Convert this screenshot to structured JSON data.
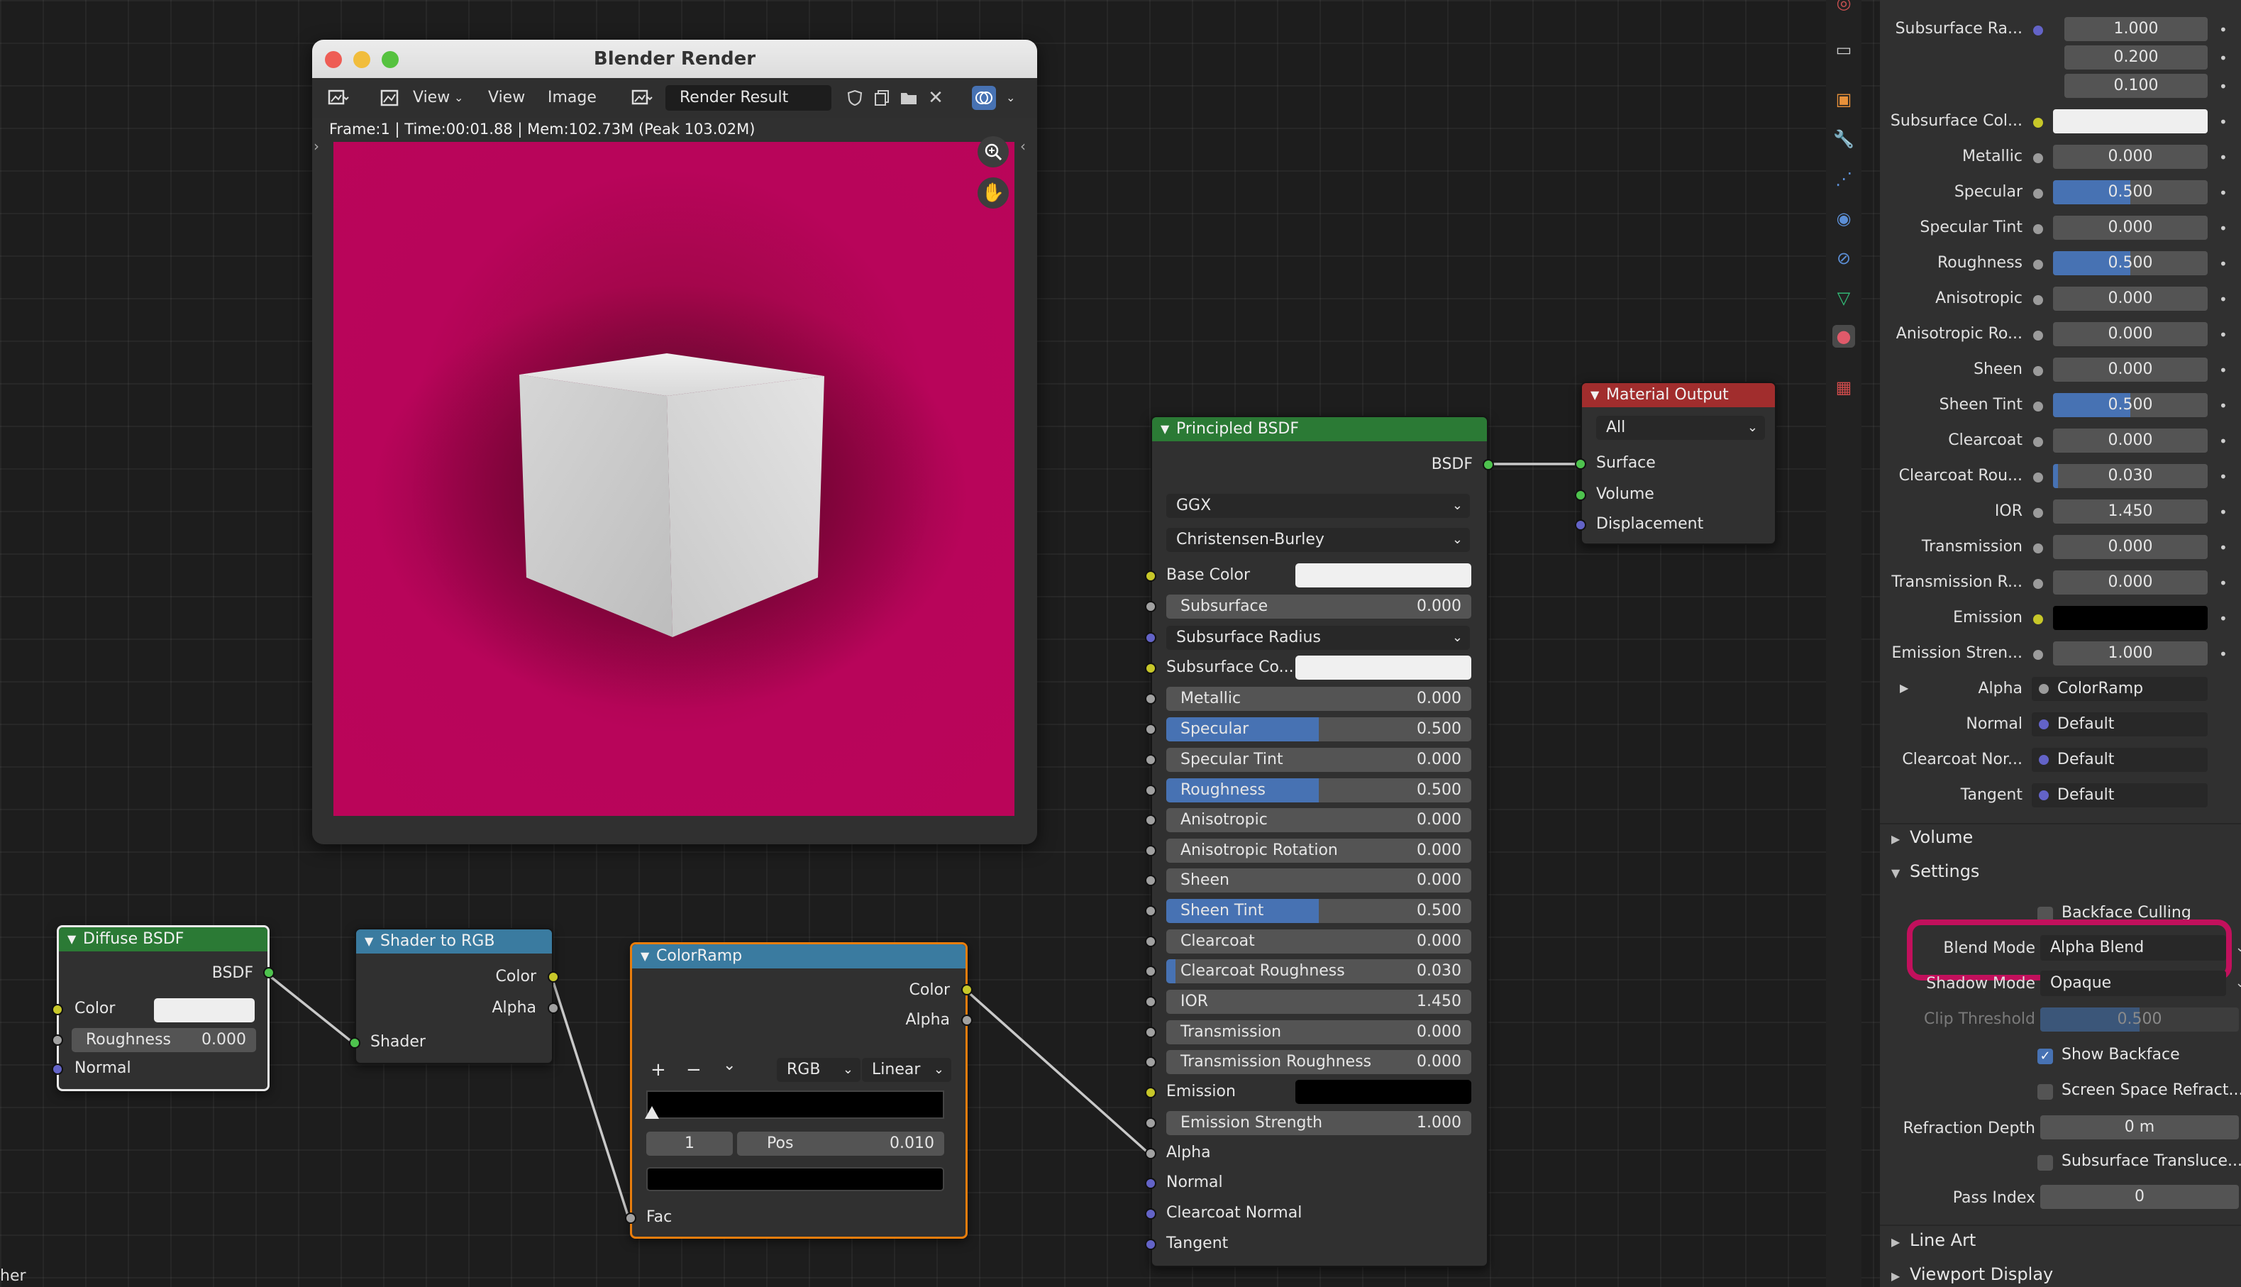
{
  "render_window": {
    "title": "Blender Render",
    "menu": [
      "View",
      "View",
      "Image"
    ],
    "result_name": "Render Result",
    "status": "Frame:1 | Time:00:01.88 | Mem:102.73M (Peak 103.02M)"
  },
  "bottom_left_text": "her",
  "diffuse_bsdf": {
    "title": "Diffuse BSDF",
    "output": "BSDF",
    "color_label": "Color",
    "roughness_label": "Roughness",
    "roughness_value": "0.000",
    "normal_label": "Normal"
  },
  "shader_to_rgb": {
    "title": "Shader to RGB",
    "out_color": "Color",
    "out_alpha": "Alpha",
    "in_shader": "Shader"
  },
  "color_ramp": {
    "title": "ColorRamp",
    "out_color": "Color",
    "out_alpha": "Alpha",
    "add": "+",
    "remove": "−",
    "more": "⌄",
    "color_mode": "RGB",
    "interpolation": "Linear",
    "index": "1",
    "pos_label": "Pos",
    "pos_value": "0.010",
    "in_fac": "Fac"
  },
  "principled_bsdf": {
    "title": "Principled BSDF",
    "output": "BSDF",
    "distribution": "GGX",
    "subsurface_method": "Christensen-Burley",
    "base_color_label": "Base Color",
    "subsurface_radius": "Subsurface Radius",
    "subsurface_color_label": "Subsurface Co...",
    "emission_label": "Emission",
    "fields": [
      {
        "label": "Subsurface",
        "value": "0.000",
        "fill": 0
      },
      {
        "label": "Metallic",
        "value": "0.000",
        "fill": 0
      },
      {
        "label": "Specular",
        "value": "0.500",
        "fill": 0.5
      },
      {
        "label": "Specular Tint",
        "value": "0.000",
        "fill": 0
      },
      {
        "label": "Roughness",
        "value": "0.500",
        "fill": 0.5
      },
      {
        "label": "Anisotropic",
        "value": "0.000",
        "fill": 0
      },
      {
        "label": "Anisotropic Rotation",
        "value": "0.000",
        "fill": 0
      },
      {
        "label": "Sheen",
        "value": "0.000",
        "fill": 0
      },
      {
        "label": "Sheen Tint",
        "value": "0.500",
        "fill": 0.5
      },
      {
        "label": "Clearcoat",
        "value": "0.000",
        "fill": 0
      },
      {
        "label": "Clearcoat Roughness",
        "value": "0.030",
        "fill": 0.03
      },
      {
        "label": "IOR",
        "value": "1.450",
        "fill": 0
      },
      {
        "label": "Transmission",
        "value": "0.000",
        "fill": 0
      },
      {
        "label": "Transmission Roughness",
        "value": "0.000",
        "fill": 0
      },
      {
        "label": "Emission Strength",
        "value": "1.000",
        "fill": 0
      }
    ],
    "inputs_bottom": [
      "Alpha",
      "Normal",
      "Clearcoat Normal",
      "Tangent"
    ]
  },
  "material_output": {
    "title": "Material Output",
    "target": "All",
    "inputs": [
      "Surface",
      "Volume",
      "Displacement"
    ]
  },
  "properties": {
    "subsurface_radius_label": "Subsurface Ra...",
    "subsurface_radius_values": [
      "1.000",
      "0.200",
      "0.100"
    ],
    "rows": [
      {
        "label": "Subsurface Col...",
        "kind": "color",
        "value": "",
        "fill": 0
      },
      {
        "label": "Metallic",
        "kind": "num",
        "value": "0.000",
        "fill": 0
      },
      {
        "label": "Specular",
        "kind": "num",
        "value": "0.500",
        "fill": 0.5
      },
      {
        "label": "Specular Tint",
        "kind": "num",
        "value": "0.000",
        "fill": 0
      },
      {
        "label": "Roughness",
        "kind": "num",
        "value": "0.500",
        "fill": 0.5
      },
      {
        "label": "Anisotropic",
        "kind": "num",
        "value": "0.000",
        "fill": 0
      },
      {
        "label": "Anisotropic Ro...",
        "kind": "num",
        "value": "0.000",
        "fill": 0
      },
      {
        "label": "Sheen",
        "kind": "num",
        "value": "0.000",
        "fill": 0
      },
      {
        "label": "Sheen Tint",
        "kind": "num",
        "value": "0.500",
        "fill": 0.5
      },
      {
        "label": "Clearcoat",
        "kind": "num",
        "value": "0.000",
        "fill": 0
      },
      {
        "label": "Clearcoat Rou...",
        "kind": "num",
        "value": "0.030",
        "fill": 0.03
      },
      {
        "label": "IOR",
        "kind": "num",
        "value": "1.450",
        "fill": 0
      },
      {
        "label": "Transmission",
        "kind": "num",
        "value": "0.000",
        "fill": 0
      },
      {
        "label": "Transmission R...",
        "kind": "num",
        "value": "0.000",
        "fill": 0
      },
      {
        "label": "Emission",
        "kind": "black",
        "value": "",
        "fill": 0
      },
      {
        "label": "Emission Stren...",
        "kind": "num",
        "value": "1.000",
        "fill": 0
      },
      {
        "label": "Alpha",
        "kind": "link",
        "value": "ColorRamp",
        "fill": 0
      },
      {
        "label": "Normal",
        "kind": "link",
        "value": "Default",
        "fill": 0
      },
      {
        "label": "Clearcoat Nor...",
        "kind": "link",
        "value": "Default",
        "fill": 0
      },
      {
        "label": "Tangent",
        "kind": "link",
        "value": "Default",
        "fill": 0
      }
    ],
    "section_volume": "Volume",
    "section_settings": "Settings",
    "backface_culling": "Backface Culling",
    "blend_mode_label": "Blend Mode",
    "blend_mode_value": "Alpha Blend",
    "shadow_mode_label": "Shadow Mode",
    "shadow_mode_value": "Opaque",
    "clip_threshold_label": "Clip Threshold",
    "clip_threshold_value": "0.500",
    "show_backface": "Show Backface",
    "screen_space_refraction": "Screen Space Refract...",
    "refraction_depth_label": "Refraction Depth",
    "refraction_depth_value": "0 m",
    "subsurface_translucency": "Subsurface Transluce...",
    "pass_index_label": "Pass Index",
    "pass_index_value": "0",
    "section_line_art": "Line Art",
    "section_viewport_display": "Viewport Display"
  },
  "colors": {
    "highlight": "#c2105c",
    "accent_blue": "#4772b3",
    "render_background": "#ba0559"
  }
}
